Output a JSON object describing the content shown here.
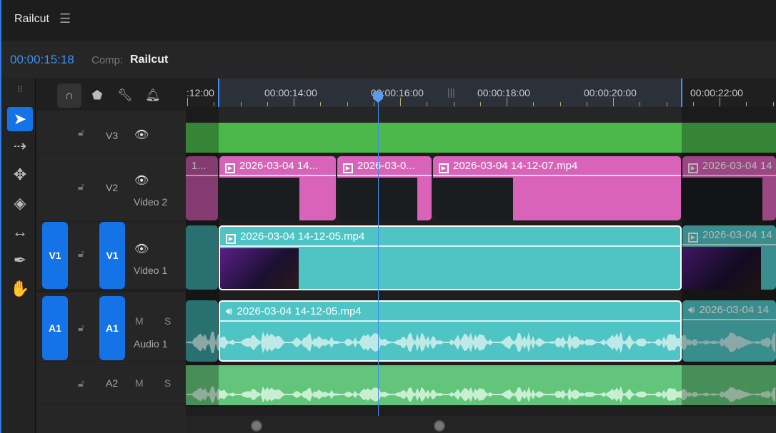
{
  "app": {
    "title": "Railcut",
    "menu_icon": "hamburger-icon"
  },
  "header": {
    "timecode": "00:00:15:18",
    "comp_label": "Comp:",
    "comp_name": "Railcut"
  },
  "colors": {
    "accent": "#1473e6",
    "video3": "#4cb84c",
    "video2": "#d863b8",
    "video1": "#4fc4c4",
    "audio1": "#4fc4c4",
    "audio2": "#63c57c"
  },
  "tools": [
    "selection-tool",
    "track-select-forward-tool",
    "ripple-edit-tool",
    "razor-tool",
    "slip-tool",
    "pen-tool",
    "hand-tool"
  ],
  "timeline_tools": [
    "snap-magnet-icon",
    "marker-icon",
    "wrench-icon",
    "bell-icon"
  ],
  "ruler": {
    "labels": [
      ":12:00",
      "00:00:14:00",
      "00:00:16:00",
      "00:00:18:00",
      "00:00:20:00",
      "00:00:22:00"
    ]
  },
  "tracks": {
    "v3": {
      "name": "V3"
    },
    "v2": {
      "name": "V2",
      "label": "Video 2"
    },
    "v1": {
      "source": "V1",
      "name": "V1",
      "label": "Video 1"
    },
    "a1": {
      "source": "A1",
      "name": "A1",
      "label": "Audio 1",
      "mute": "M",
      "solo": "S"
    },
    "a2": {
      "name": "A2",
      "mute": "M",
      "solo": "S"
    }
  },
  "clips": {
    "v2": [
      "1...",
      "2026-03-04 14...",
      "2026-03-0...",
      "2026-03-04 14-12-07.mp4",
      "2026-03-04 14"
    ],
    "v1": [
      "2026-03-04 14-12-05.mp4",
      "2026-03-04 14"
    ],
    "a1": [
      "2026-03-04 14-12-05.mp4",
      "2026-03-04 14"
    ]
  }
}
